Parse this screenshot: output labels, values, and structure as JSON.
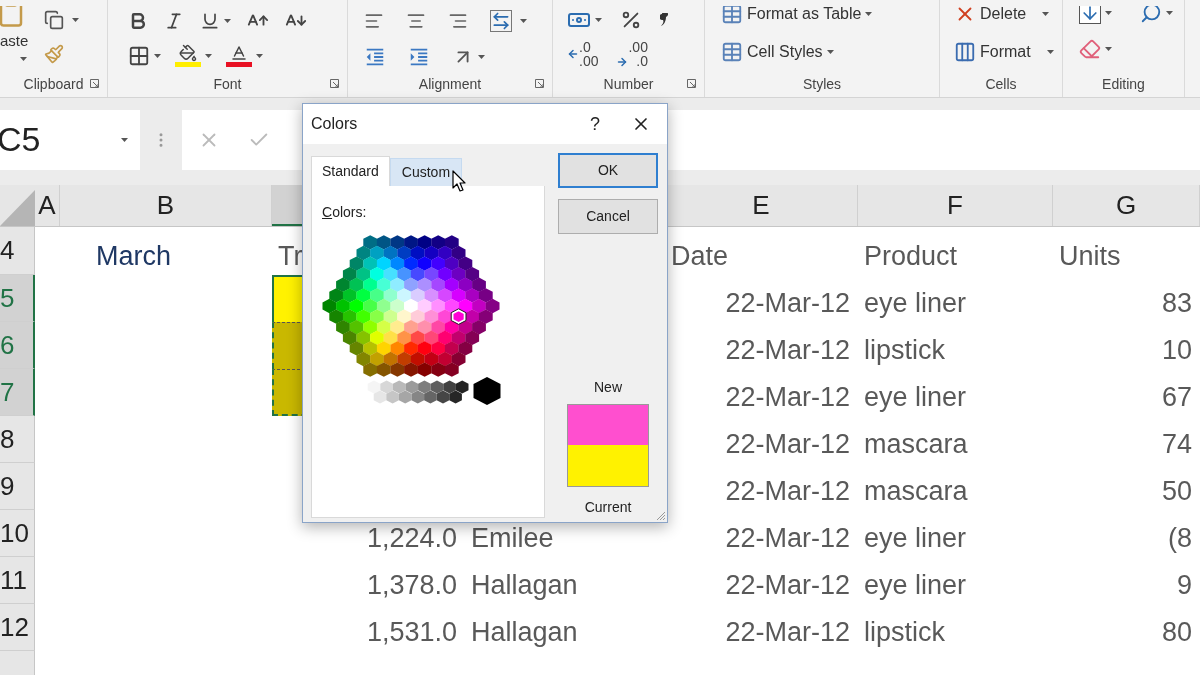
{
  "ribbon": {
    "paste_label": "aste",
    "groups": [
      {
        "label": "Clipboard",
        "launcher": true
      },
      {
        "label": "Font",
        "launcher": true
      },
      {
        "label": "Alignment",
        "launcher": true
      },
      {
        "label": "Number",
        "launcher": true
      },
      {
        "label": "Styles",
        "launcher": false
      },
      {
        "label": "Cells",
        "launcher": false
      },
      {
        "label": "Editing",
        "launcher": false
      }
    ],
    "increase_decimal": {
      "top": ".0",
      "bottom": ".00"
    },
    "decrease_decimal": {
      "top": ".00",
      "bottom": ".0"
    },
    "styles_buttons": [
      "Format as Table",
      "Cell Styles"
    ],
    "cells_buttons": [
      "Delete",
      "Format"
    ]
  },
  "formula_bar": {
    "name_box": "C5"
  },
  "columns": [
    {
      "label": "A",
      "selected": false
    },
    {
      "label": "B",
      "selected": false
    },
    {
      "selected": true
    },
    {
      "label": "E",
      "selected": false
    },
    {
      "label": "F",
      "selected": false
    },
    {
      "label": "G",
      "selected": false
    }
  ],
  "rows": [
    {
      "header": "4",
      "selected": false,
      "kind": "heading",
      "b": "March",
      "c": "Tr",
      "e": "Date",
      "f": "Product",
      "g": "Units"
    },
    {
      "header": "5",
      "selected": true,
      "kind": "data",
      "color": "#fff200",
      "e": "22-Mar-12",
      "f": "eye liner",
      "g": "83"
    },
    {
      "header": "6",
      "selected": true,
      "kind": "data",
      "color": "#c9b800",
      "e": "22-Mar-12",
      "f": "lipstick",
      "g": "10"
    },
    {
      "header": "7",
      "selected": true,
      "kind": "data",
      "color": "#c9b800",
      "e": "22-Mar-12",
      "f": "eye liner",
      "g": "67"
    },
    {
      "header": "8",
      "selected": false,
      "kind": "data",
      "e": "22-Mar-12",
      "f": "mascara",
      "g": "74"
    },
    {
      "header": "9",
      "selected": false,
      "kind": "data",
      "e": "22-Mar-12",
      "f": "mascara",
      "g": "50"
    },
    {
      "header": "10",
      "selected": false,
      "kind": "data",
      "c": "1,224.0",
      "d": "Emilee",
      "e": "22-Mar-12",
      "f": "eye liner",
      "g": "(8"
    },
    {
      "header": "11",
      "selected": false,
      "kind": "data",
      "c": "1,378.0",
      "d": "Hallagan",
      "e": "22-Mar-12",
      "f": "eye liner",
      "g": "9"
    },
    {
      "header": "12",
      "selected": false,
      "kind": "data",
      "c": "1,531.0",
      "d": "Hallagan",
      "e": "22-Mar-12",
      "f": "lipstick",
      "g": "80"
    }
  ],
  "dialog": {
    "title": "Colors",
    "help": "?",
    "tabs": [
      {
        "label": "Standard",
        "selected": true,
        "hovered": false
      },
      {
        "label": "Custom",
        "selected": false,
        "hovered": true
      }
    ],
    "colors_label": "Colors:",
    "swatches": [
      {
        "label": "New",
        "color": "#ff4fcf"
      },
      {
        "label": "Current",
        "color": "#fff200"
      }
    ],
    "buttons": [
      {
        "label": "OK",
        "default": true
      },
      {
        "label": "Cancel",
        "default": false
      }
    ]
  }
}
